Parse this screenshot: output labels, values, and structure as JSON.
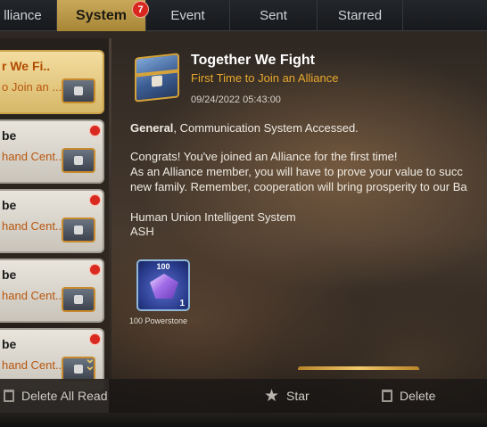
{
  "tabs": [
    {
      "label": "lliance",
      "active": false
    },
    {
      "label": "System",
      "active": true,
      "badge": "7"
    },
    {
      "label": "Event",
      "active": false
    },
    {
      "label": "Sent",
      "active": false
    },
    {
      "label": "Starred",
      "active": false
    }
  ],
  "mail_list": [
    {
      "title": "r We Fi..",
      "subtitle": "o Join an ...",
      "selected": true,
      "unread": false
    },
    {
      "title": "be",
      "subtitle": "hand Cent...",
      "selected": false,
      "unread": true
    },
    {
      "title": "be",
      "subtitle": "hand Cent...",
      "selected": false,
      "unread": true
    },
    {
      "title": "be",
      "subtitle": "hand Cent...",
      "selected": false,
      "unread": true
    },
    {
      "title": "be",
      "subtitle": "hand Cent...",
      "selected": false,
      "unread": true
    }
  ],
  "mail": {
    "title": "Together We Fight",
    "subtitle": "First Time to Join an Alliance",
    "date": "09/24/2022 05:43:00",
    "greeting_bold": "General",
    "greeting_rest": ", Communication System Accessed.",
    "line1": "Congrats! You've joined an Alliance for the first time!",
    "line2": "As an Alliance member, you will have to prove your value to succ",
    "line3": "new family. Remember, cooperation will bring prosperity to our Ba",
    "signature1": "Human Union Intelligent System",
    "signature2": "ASH"
  },
  "reward": {
    "top_label": "100",
    "count": "1",
    "label": "100 Powerstone"
  },
  "bottom_bar": {
    "delete_all_read": "Delete All Read",
    "star": "Star",
    "delete": "Delete"
  },
  "colors": {
    "tab_active": "#b8963f",
    "mail_subtitle": "#e8a82a",
    "unread_dot": "#d82a20"
  }
}
